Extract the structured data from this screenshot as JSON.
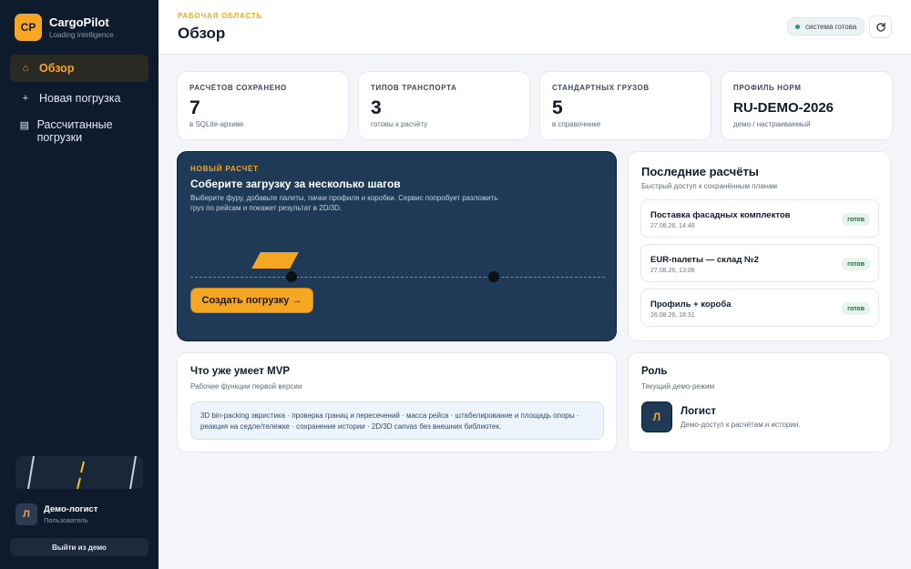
{
  "brand": {
    "logo": "CP",
    "name": "CargoPilot",
    "tagline": "Loading intelligence"
  },
  "nav": {
    "items": [
      {
        "label": "Обзор",
        "icon": "home-icon",
        "glyph": "⌂",
        "active": true
      },
      {
        "label": "Новая погрузка",
        "icon": "plus-icon",
        "glyph": "+"
      },
      {
        "label": "Рассчитанные погрузки",
        "icon": "list-icon",
        "glyph": "▤"
      }
    ]
  },
  "user": {
    "initial": "Л",
    "name": "Демо-логист",
    "role": "Пользователь",
    "logout": "Выйти из демо"
  },
  "header": {
    "eyebrow": "РАБОЧАЯ ОБЛАСТЬ",
    "title": "Обзор",
    "status": "система готова",
    "refresh_icon": "refresh-icon"
  },
  "stats": [
    {
      "label": "РАСЧЁТОВ СОХРАНЕНО",
      "value": "7",
      "sub": "в SQLite-архиве"
    },
    {
      "label": "ТИПОВ ТРАНСПОРТА",
      "value": "3",
      "sub": "готовы к расчёту"
    },
    {
      "label": "СТАНДАРТНЫХ ГРУЗОВ",
      "value": "5",
      "sub": "в справочнике"
    },
    {
      "label": "ПРОФИЛЬ НОРМ",
      "value": "RU-DEMO-2026",
      "sub": "демо / настраиваемый"
    }
  ],
  "hero": {
    "eyebrow": "НОВЫЙ РАСЧЁТ",
    "title": "Соберите загрузку за несколько шагов",
    "description": "Выберите фуру, добавьте палеты, пачки профиля и коробки. Сервис попробует разложить груз по рейсам и покажет результат в 2D/3D.",
    "cta": "Создать погрузку →"
  },
  "recent": {
    "title": "Последние расчёты",
    "subtitle": "Быстрый доступ к сохранённым планам",
    "items": [
      {
        "title": "Поставка фасадных комплектов",
        "date": "27.08.26, 14:48",
        "status": "готов"
      },
      {
        "title": "EUR-палеты — склад №2",
        "date": "27.08.26, 13:06",
        "status": "готов"
      },
      {
        "title": "Профиль + короба",
        "date": "26.08.26, 18:31",
        "status": "готов"
      }
    ]
  },
  "mvp": {
    "title": "Что уже умеет MVP",
    "subtitle": "Рабочие функции первой версии",
    "features": "3D bin-packing эвристика · проверка границ и пересечений · масса рейса · штабелирование и площадь опоры · реакция на седле/тележке · сохранение истории · 2D/3D canvas без внешних библиотек."
  },
  "role": {
    "title": "Роль",
    "subtitle": "Текущий демо-режим",
    "initial": "Л",
    "name": "Логист",
    "description": "Демо-доступ к расчётам и истории."
  },
  "colors": {
    "accent": "#f5a623",
    "sidebar": "#0e1b2c",
    "hero": "#1e3a57",
    "success": "#22a06b"
  }
}
